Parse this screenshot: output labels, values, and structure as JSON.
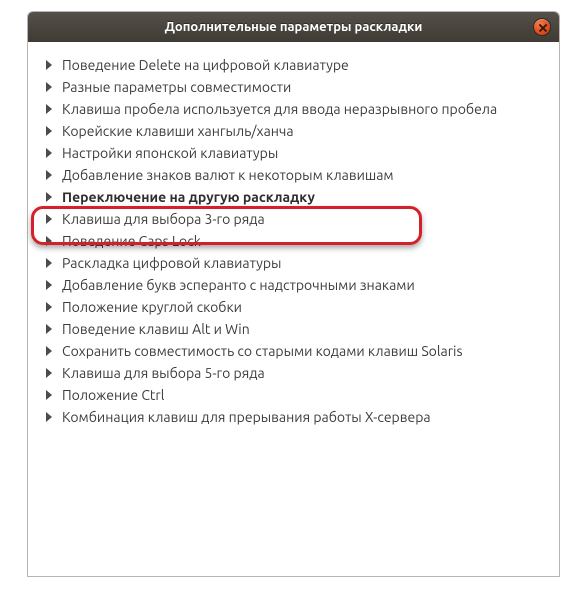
{
  "window": {
    "title": "Дополнительные параметры раскладки",
    "close_icon": "close"
  },
  "items": [
    {
      "label": "Поведение Delete на цифровой клавиатуре",
      "highlighted": false
    },
    {
      "label": "Разные параметры совместимости",
      "highlighted": false
    },
    {
      "label": "Клавиша пробела используется для ввода неразрывного пробела",
      "highlighted": false
    },
    {
      "label": "Корейские клавиши хангыль/ханча",
      "highlighted": false
    },
    {
      "label": "Настройки японской клавиатуры",
      "highlighted": false
    },
    {
      "label": "Добавление знаков валют к некоторым клавишам",
      "highlighted": false
    },
    {
      "label": "Переключение на другую раскладку",
      "highlighted": true
    },
    {
      "label": "Клавиша для выбора 3-го ряда",
      "highlighted": false
    },
    {
      "label": "Поведение Caps Lock",
      "highlighted": false
    },
    {
      "label": "Раскладка цифровой клавиатуры",
      "highlighted": false
    },
    {
      "label": "Добавление букв эсперанто с надстрочными знаками",
      "highlighted": false
    },
    {
      "label": "Положение круглой скобки",
      "highlighted": false
    },
    {
      "label": "Поведение клавиш Alt и Win",
      "highlighted": false
    },
    {
      "label": "Сохранить совместимость со старыми кодами клавиш Solaris",
      "highlighted": false
    },
    {
      "label": "Клавиша для выбора 5-го ряда",
      "highlighted": false
    },
    {
      "label": "Положение Ctrl",
      "highlighted": false
    },
    {
      "label": "Комбинация клавиш для прерывания работы X-сервера",
      "highlighted": false
    }
  ]
}
